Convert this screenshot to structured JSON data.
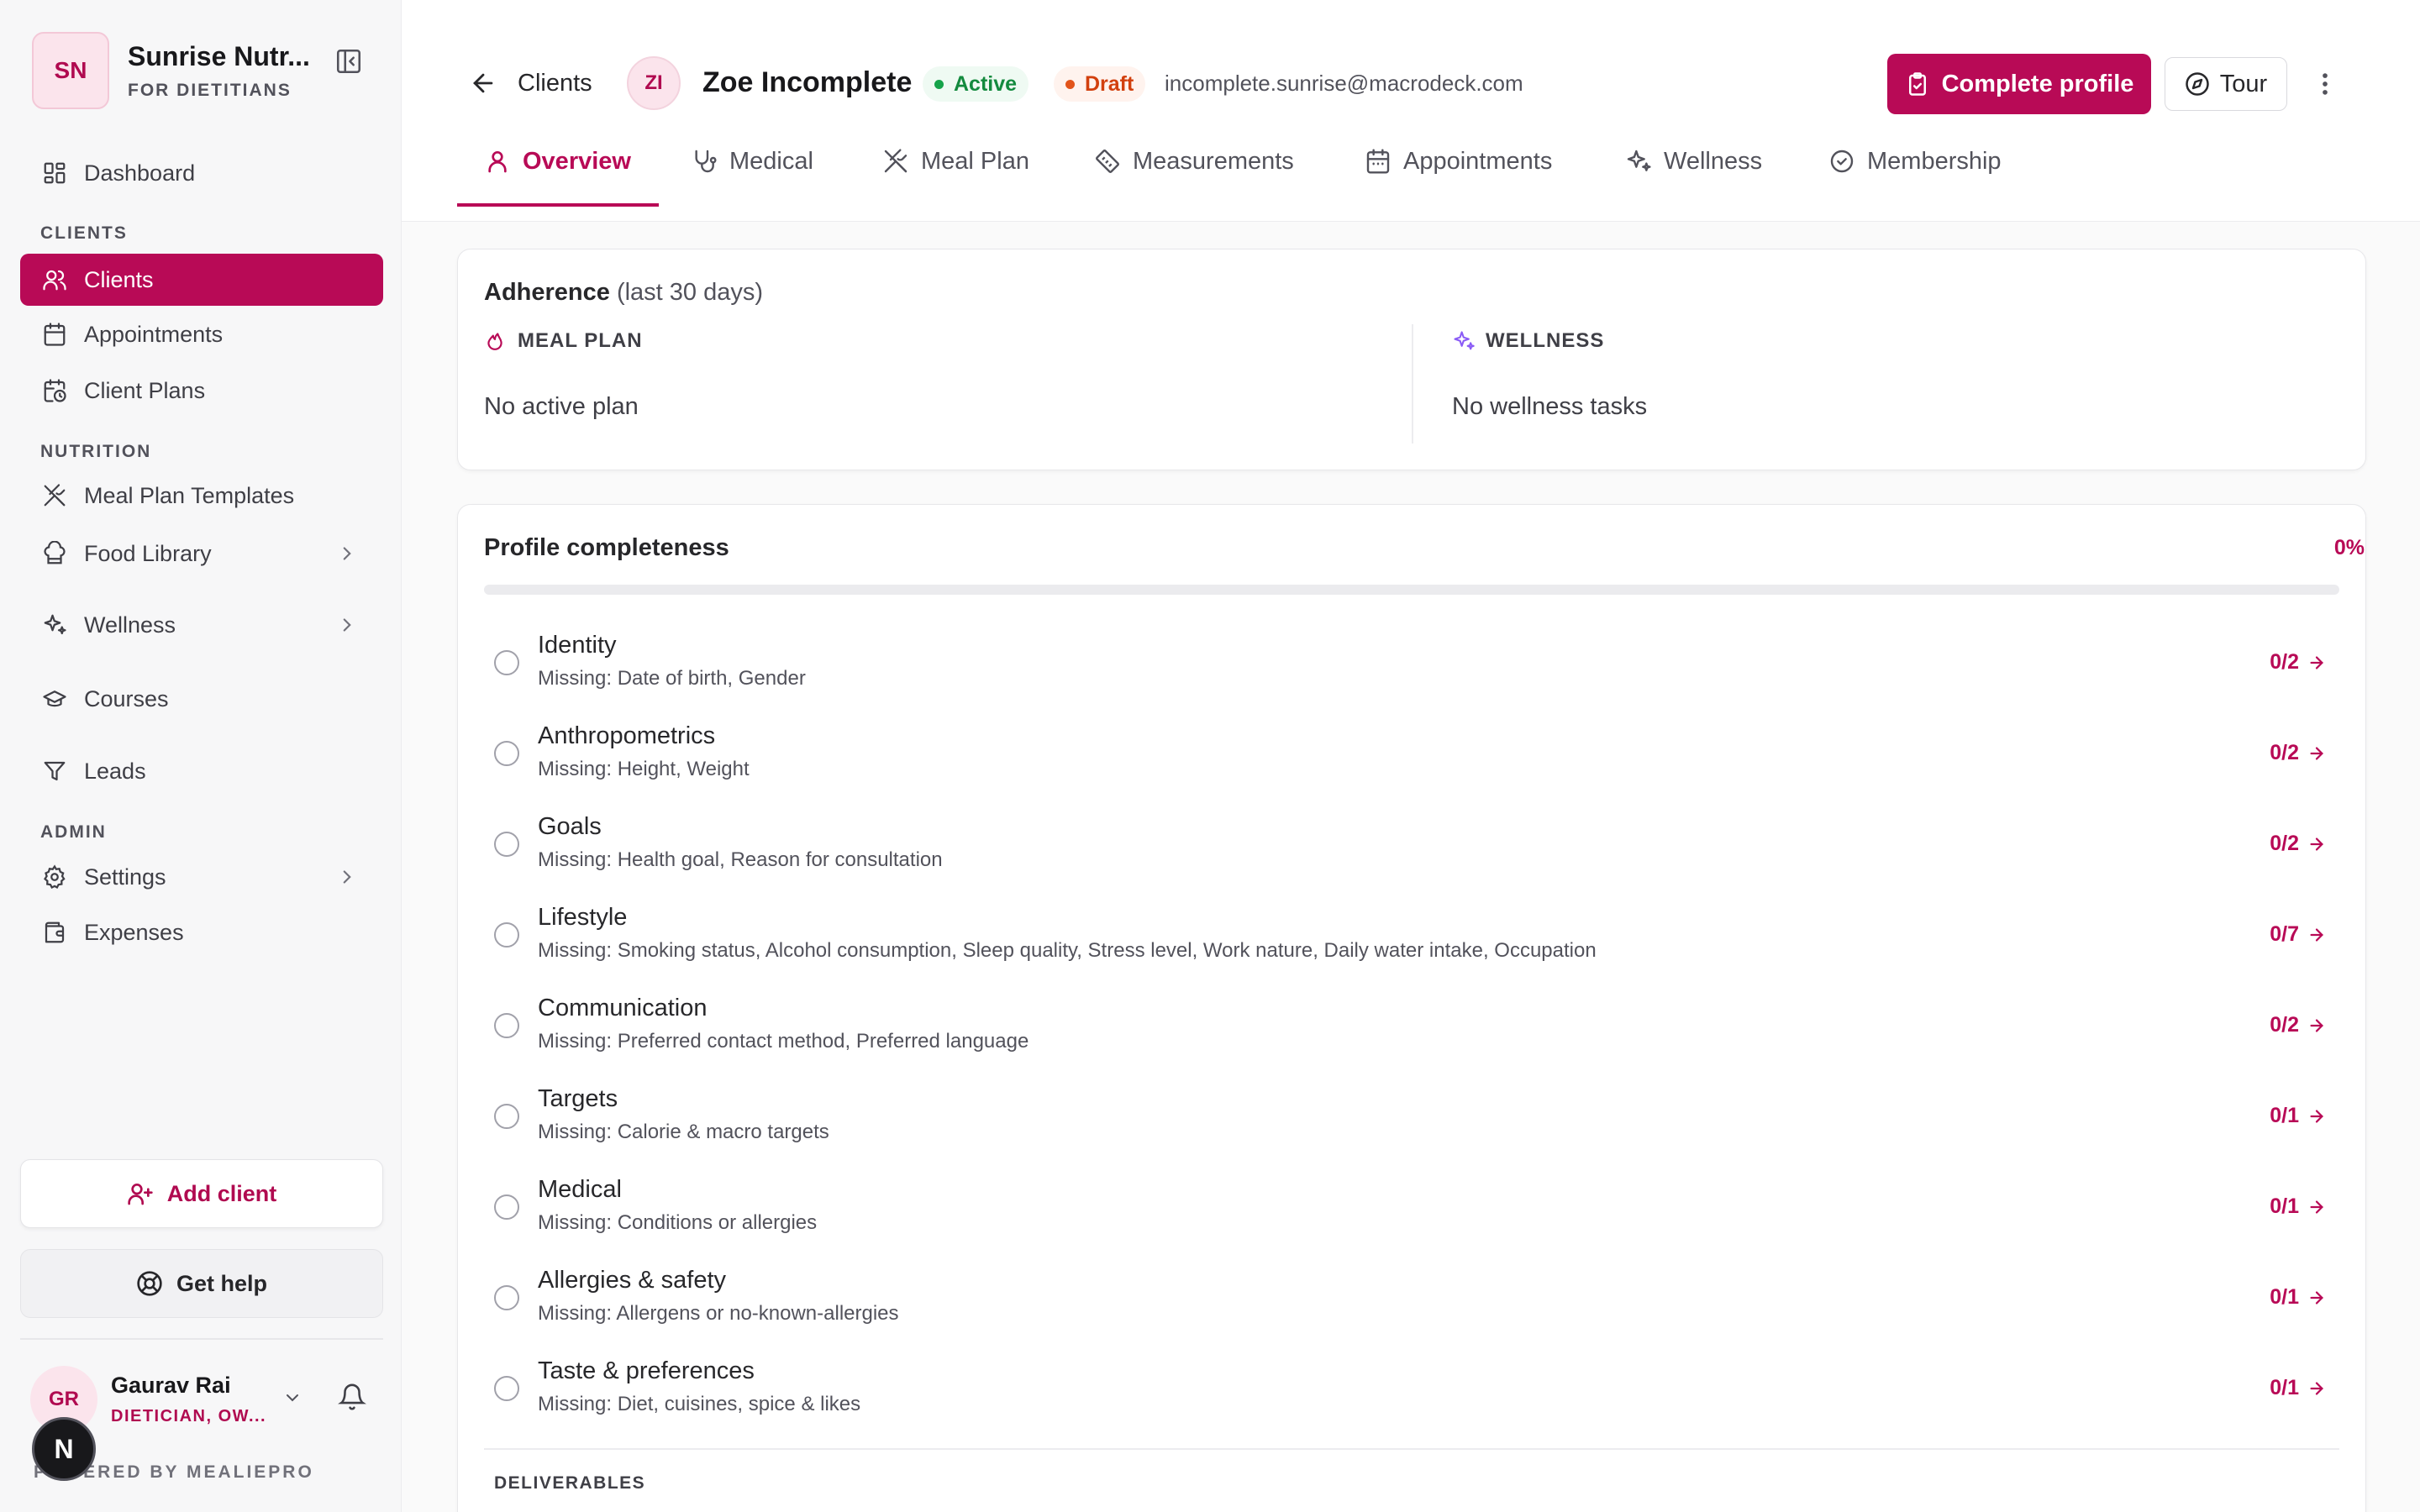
{
  "sidebar": {
    "brand_initials": "SN",
    "brand_name": "Sunrise Nutr...",
    "brand_sub": "FOR DIETITIANS",
    "dashboard": "Dashboard",
    "section_clients": "CLIENTS",
    "clients": "Clients",
    "appointments": "Appointments",
    "client_plans": "Client Plans",
    "section_nutrition": "NUTRITION",
    "meal_plan_templates": "Meal Plan Templates",
    "food_library": "Food Library",
    "wellness": "Wellness",
    "courses": "Courses",
    "leads": "Leads",
    "section_admin": "ADMIN",
    "settings": "Settings",
    "expenses": "Expenses",
    "add_client": "Add client",
    "get_help": "Get help",
    "user_initials": "GR",
    "user_name": "Gaurav Rai",
    "user_role": "DIETICIAN, OW...",
    "powered_by": "POWERED BY MEALIEPRO",
    "n_badge": "N"
  },
  "header": {
    "breadcrumb": "Clients",
    "client_initials": "ZI",
    "client_name": "Zoe Incomplete",
    "status_active": "Active",
    "status_draft": "Draft",
    "email": "incomplete.sunrise@macrodeck.com",
    "complete_profile": "Complete profile",
    "tour": "Tour"
  },
  "tabs": {
    "overview": "Overview",
    "medical": "Medical",
    "meal_plan": "Meal Plan",
    "measurements": "Measurements",
    "appointments": "Appointments",
    "wellness": "Wellness",
    "membership": "Membership"
  },
  "adherence": {
    "title": "Adherence",
    "period": "(last 30 days)",
    "meal_plan_label": "MEAL PLAN",
    "meal_plan_value": "No active plan",
    "wellness_label": "WELLNESS",
    "wellness_value": "No wellness tasks"
  },
  "profile": {
    "title": "Profile completeness",
    "percent": "0%",
    "progress_fraction": 0,
    "items": [
      {
        "title": "Identity",
        "missing": "Missing: Date of birth, Gender",
        "count": "0/2"
      },
      {
        "title": "Anthropometrics",
        "missing": "Missing: Height, Weight",
        "count": "0/2"
      },
      {
        "title": "Goals",
        "missing": "Missing: Health goal, Reason for consultation",
        "count": "0/2"
      },
      {
        "title": "Lifestyle",
        "missing": "Missing: Smoking status, Alcohol consumption, Sleep quality, Stress level, Work nature, Daily water intake, Occupation",
        "count": "0/7"
      },
      {
        "title": "Communication",
        "missing": "Missing: Preferred contact method, Preferred language",
        "count": "0/2"
      },
      {
        "title": "Targets",
        "missing": "Missing: Calorie & macro targets",
        "count": "0/1"
      },
      {
        "title": "Medical",
        "missing": "Missing: Conditions or allergies",
        "count": "0/1"
      },
      {
        "title": "Allergies & safety",
        "missing": "Missing: Allergens or no-known-allergies",
        "count": "0/1"
      },
      {
        "title": "Taste & preferences",
        "missing": "Missing: Diet, cuisines, spice & likes",
        "count": "0/1"
      }
    ],
    "deliverables_label": "DELIVERABLES"
  },
  "colors": {
    "accent": "#b80a56",
    "active_green": "#16a34a",
    "draft_orange": "#e2541a",
    "wellness_purple": "#8b5cf6"
  }
}
